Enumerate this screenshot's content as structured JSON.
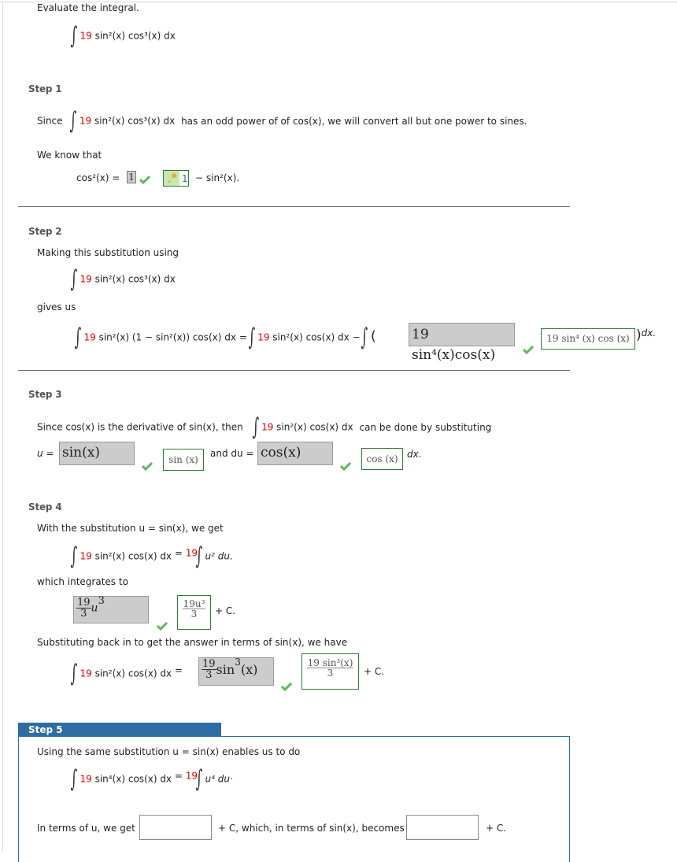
{
  "question": {
    "prompt": "Evaluate the integral.",
    "coef": "19",
    "integrand_rest": " sin²(x) cos³(x) dx"
  },
  "step1": {
    "label": "Step 1",
    "since": "Since",
    "coef": "19",
    "integrand_rest": " sin²(x) cos³(x) dx",
    "explanation": "has an odd power of of cos(x), we will convert all but one power to sines.",
    "we_know": "We know that",
    "lhs": "cos²(x) =",
    "answer_value": "1",
    "correct_answer": "1",
    "rhs": "− sin²(x)."
  },
  "step2": {
    "label": "Step 2",
    "intro": "Making this substitution using",
    "coef": "19",
    "integrand_rest": " sin²(x) cos³(x) dx",
    "gives_us": "gives us",
    "expanded_coef": "19",
    "expanded_rest": " sin²(x) (1 − sin²(x)) cos(x) dx",
    "equals": "=",
    "term1_coef": "19",
    "term1_rest": " sin²(x) cos(x) dx",
    "minus": "−",
    "open_paren": "(",
    "answer_value": "19 sin⁴(x)cos(x)",
    "correct_answer": "19 sin⁴ (x) cos (x)",
    "close": ") dx."
  },
  "step3": {
    "label": "Step 3",
    "since": "Since  cos(x)  is the derivative of  sin(x),  then",
    "coef": "19",
    "integrand_rest": " sin²(x) cos(x) dx",
    "tail": "can be done by substituting",
    "u_label": "u =",
    "u_value": "sin(x)",
    "u_correct": "sin (x)",
    "and_du": "and  du =",
    "du_value": "cos(x)",
    "du_correct": "cos (x)",
    "dx": "dx."
  },
  "step4": {
    "label": "Step 4",
    "intro": "With the substitution  u = sin(x),  we get",
    "coef": "19",
    "integrand_rest": " sin²(x) cos(x) dx",
    "equals": "=",
    "rhs_coef": "19",
    "rhs_rest": "u² du.",
    "integrates_to": "which integrates to",
    "answer_num": "19",
    "answer_den": "3",
    "answer_var": "u",
    "answer_exp": "3",
    "correct_num": "19u³",
    "correct_den": "3",
    "plus_c": "+ C.",
    "back_sub": "Substituting back in to get the answer in terms of sin(x), we have",
    "final_coef": "19",
    "final_rest": " sin²(x) cos(x) dx",
    "final_equals": "=",
    "final_num": "19",
    "final_den": "3",
    "final_fn": "sin",
    "final_exp": "3",
    "final_arg": "(x)",
    "final_correct_num": "19 sin³(x)",
    "final_correct_den": "3",
    "final_plus_c": "+ C."
  },
  "step5": {
    "label": "Step 5",
    "intro": "Using the same substitution  u = sin(x)  enables us to do",
    "coef": "19",
    "integrand_rest": " sin⁴(x) cos(x) dx",
    "equals": "=",
    "rhs_coef": "19",
    "rhs_rest": "u⁴ du·",
    "in_terms_u": "In terms of u, we get",
    "u_input_value": "",
    "middle": "+ C, which, in terms of sin(x), becomes",
    "sin_input_value": "",
    "plus_c": "+ C."
  },
  "colors": {
    "coefficient": "#e00000",
    "correct_border": "#2e7d32",
    "check": "#5cb85c",
    "step5_header": "#2e6da4",
    "answer_bg": "#cccccc"
  }
}
